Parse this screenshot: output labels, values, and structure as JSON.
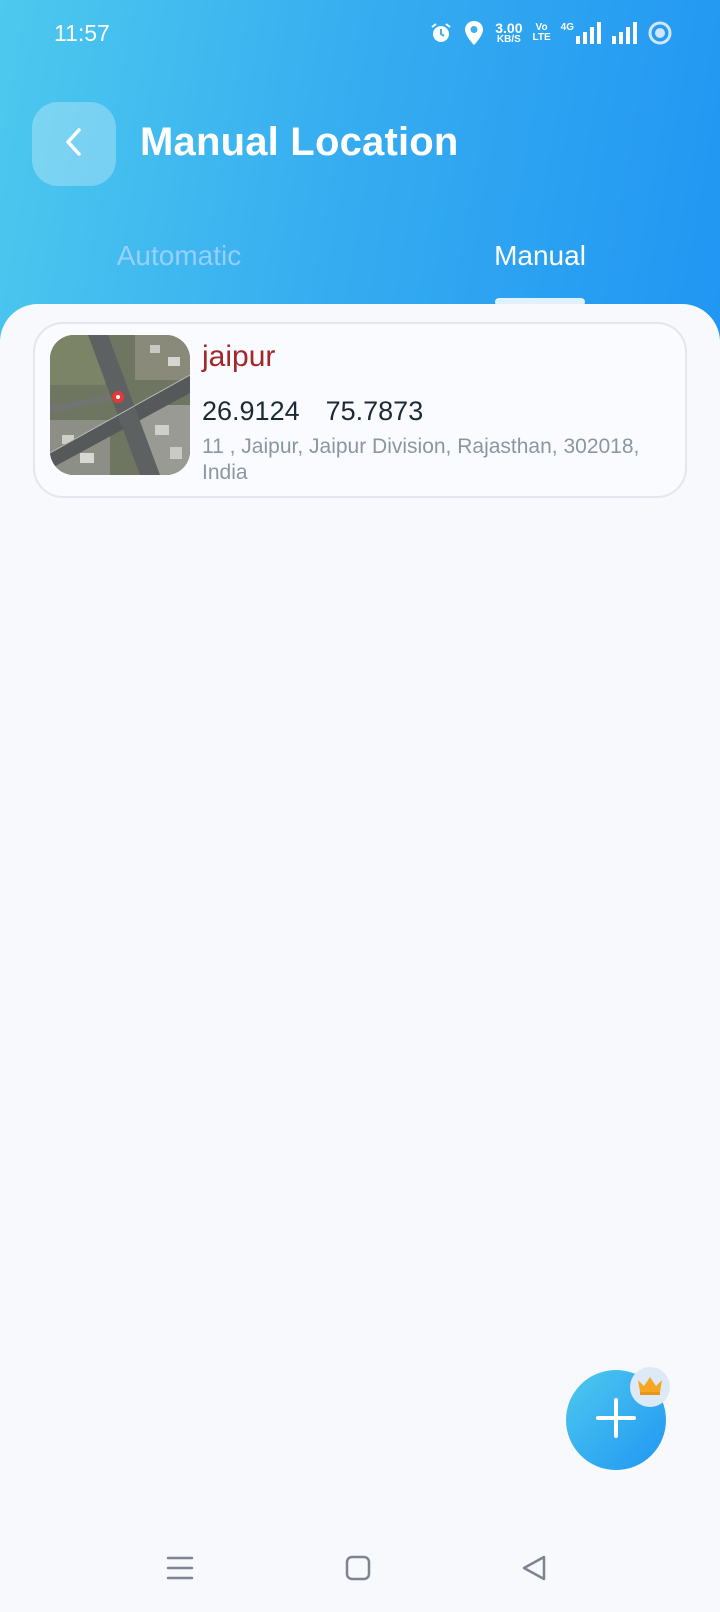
{
  "status_bar": {
    "time": "11:57",
    "net_speed_value": "3.00",
    "net_speed_unit": "KB/S",
    "volte_top": "Vo",
    "volte_bottom": "LTE",
    "network_type": "4G",
    "icons": [
      "alarm-icon",
      "location-pin-icon",
      "signal-icon",
      "signal-icon",
      "circle-status-icon"
    ]
  },
  "header": {
    "title": "Manual Location",
    "back_icon": "chevron-left-icon"
  },
  "tabs": [
    {
      "label": "Automatic",
      "active": false
    },
    {
      "label": "Manual",
      "active": true
    }
  ],
  "locations": [
    {
      "name": "jaipur",
      "latitude": "26.9124",
      "longitude": "75.7873",
      "address": "11 , Jaipur, Jaipur Division, Rajasthan, 302018, India",
      "thumbnail": "satellite-map-thumbnail"
    }
  ],
  "fab": {
    "icon": "plus-icon",
    "badge_icon": "crown-icon"
  },
  "colors": {
    "header_gradient_start": "#4dc9ee",
    "header_gradient_end": "#2196f3",
    "location_name": "#a3262a",
    "background": "#f7f9fd",
    "crown": "#f5a623"
  },
  "nav_bar": {
    "icons": [
      "menu-icon",
      "home-square-icon",
      "back-triangle-icon"
    ]
  }
}
